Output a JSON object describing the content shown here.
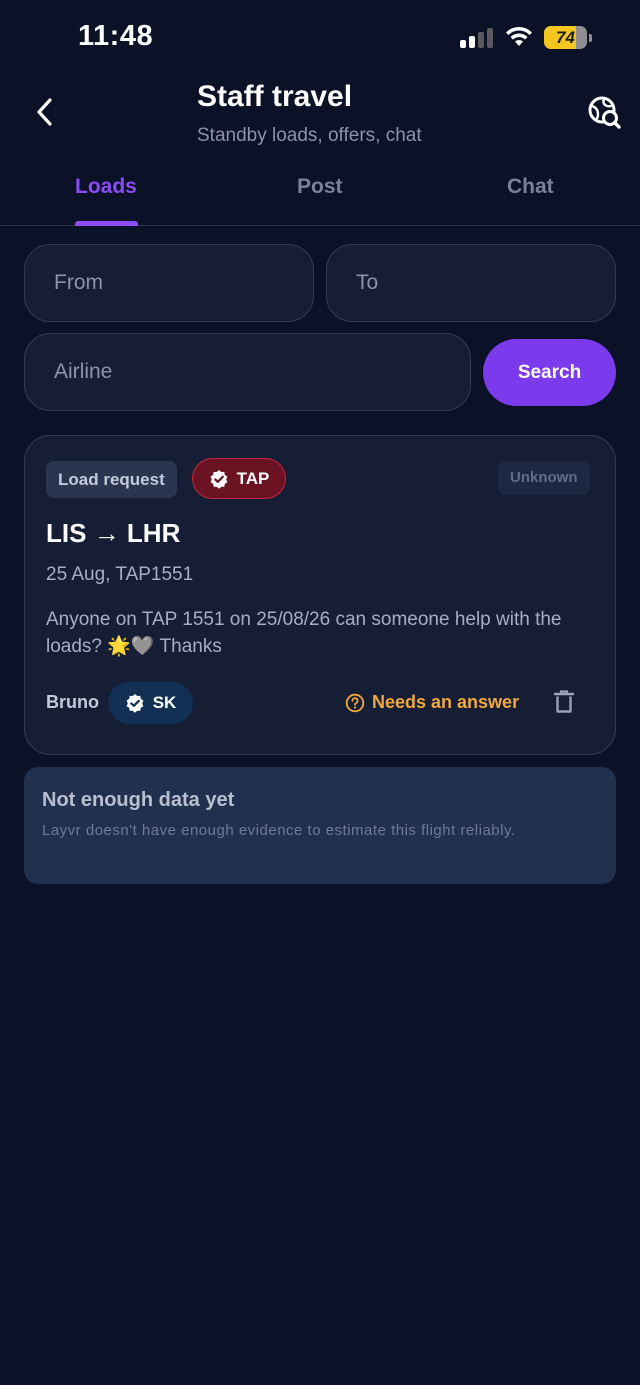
{
  "status_bar": {
    "time": "11:48",
    "battery": "74",
    "battery_level": 0.74
  },
  "header": {
    "title": "Staff travel",
    "subtitle": "Standby loads, offers, chat"
  },
  "tabs": [
    {
      "label": "Loads",
      "active": true
    },
    {
      "label": "Post",
      "active": false
    },
    {
      "label": "Chat",
      "active": false
    }
  ],
  "search": {
    "from_placeholder": "From",
    "to_placeholder": "To",
    "airline_placeholder": "Airline",
    "button_label": "Search"
  },
  "card": {
    "type_label": "Load request",
    "airline_badge": "TAP",
    "status": "Unknown",
    "route_from": "LIS",
    "route_arrow": "→",
    "route_to": "LHR",
    "flight_info": "25 Aug, TAP1551",
    "message": "Anyone on TAP 1551 on 25/08/26 can someone help with the loads? 🌟🩶  Thanks",
    "author": "Bruno",
    "author_badge": "SK",
    "needs_answer": "Needs an answer"
  },
  "info": {
    "title": "Not enough data yet",
    "text": "Layvr doesn't have enough evidence to estimate this flight reliably."
  },
  "colors": {
    "background": "#0b1126",
    "accent": "#7c3aed",
    "tab_active": "#8b4cf7",
    "warning": "#f0a73b",
    "airline_badge": "#6b1322"
  }
}
